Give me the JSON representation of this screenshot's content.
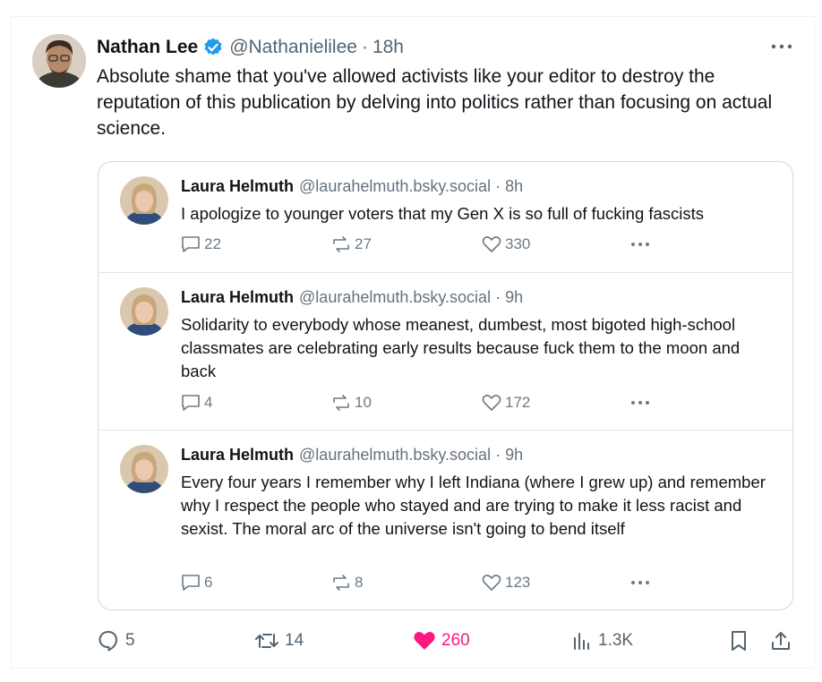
{
  "tweet": {
    "author_name": "Nathan Lee",
    "handle": "@Nathanielilee",
    "separator": "·",
    "time": "18h",
    "text": "Absolute shame that you've allowed activists like your editor to destroy the reputation of this publication by delving into politics rather than focusing on actual science.",
    "verified_color": "#1d9bf0",
    "avatar_icon": "man-avatar",
    "actions": {
      "replies": "5",
      "reposts": "14",
      "likes": "260",
      "views": "1.3K"
    },
    "like_color": "#f91880"
  },
  "quoted_posts": [
    {
      "author_name": "Laura Helmuth",
      "handle": "@laurahelmuth.bsky.social",
      "separator": "·",
      "time": "8h",
      "text": "I apologize to younger voters that my Gen X is so full of fucking fascists",
      "replies": "22",
      "reposts": "27",
      "likes": "330"
    },
    {
      "author_name": "Laura Helmuth",
      "handle": "@laurahelmuth.bsky.social",
      "separator": "·",
      "time": "9h",
      "text": "Solidarity to everybody whose meanest, dumbest, most bigoted high-school classmates are celebrating early results because fuck them to the moon and back",
      "replies": "4",
      "reposts": "10",
      "likes": "172"
    },
    {
      "author_name": "Laura Helmuth",
      "handle": "@laurahelmuth.bsky.social",
      "separator": "·",
      "time": "9h",
      "text": "Every four years I remember why I left Indiana (where I grew up) and remember why I respect the people who stayed and are trying to make it less racist and sexist. The moral arc of the universe isn't going to bend itself",
      "replies": "6",
      "reposts": "8",
      "likes": "123"
    }
  ]
}
